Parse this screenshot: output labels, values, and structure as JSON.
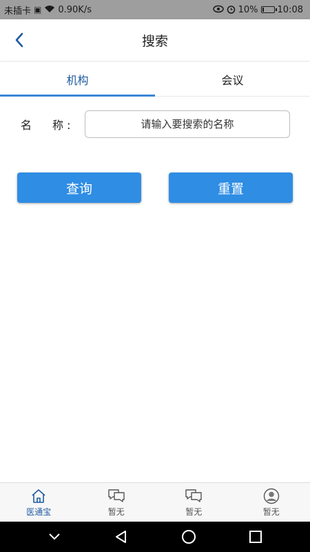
{
  "status_bar": {
    "carrier": "未插卡",
    "speed": "0.90K/s",
    "battery": "10%",
    "battery_level": 0.1,
    "time": "10:08"
  },
  "header": {
    "title": "搜索",
    "back_icon": "chevron-left-icon"
  },
  "tabs": [
    {
      "label": "机构",
      "active": true
    },
    {
      "label": "会议",
      "active": false
    }
  ],
  "form": {
    "name_label_1": "名",
    "name_label_2": "称 :",
    "name_placeholder": "请输入要搜索的名称",
    "name_value": ""
  },
  "buttons": {
    "query": "查询",
    "reset": "重置"
  },
  "bottom_nav": [
    {
      "label": "医通宝",
      "icon": "home-icon",
      "active": true
    },
    {
      "label": "暂无",
      "icon": "chat-icon",
      "active": false
    },
    {
      "label": "暂无",
      "icon": "chat-icon",
      "active": false
    },
    {
      "label": "暂无",
      "icon": "user-icon",
      "active": false
    }
  ],
  "colors": {
    "accent": "#2f8de4",
    "active_text": "#1e5aa0",
    "status_bar_bg": "#9e9e9e"
  }
}
